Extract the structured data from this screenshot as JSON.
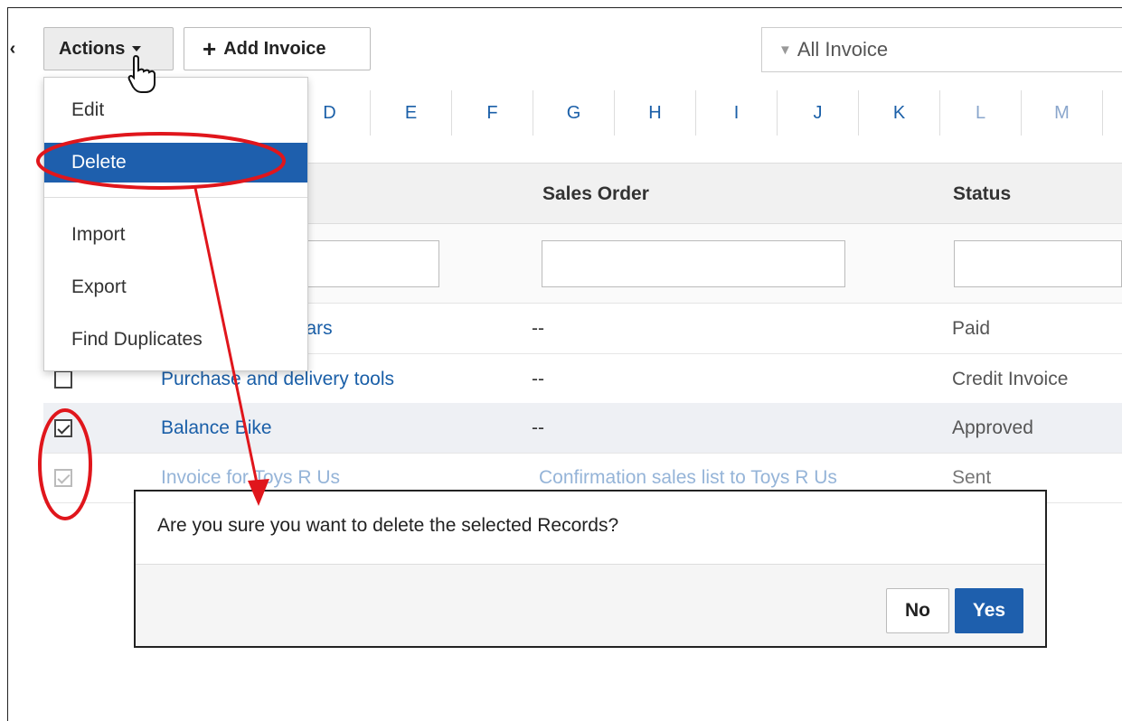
{
  "toolbar": {
    "actions_label": "Actions",
    "add_invoice_label": "Add Invoice",
    "filter_label": "All Invoice"
  },
  "alphabet": [
    "D",
    "E",
    "F",
    "G",
    "H",
    "I",
    "J",
    "K",
    "L",
    "M"
  ],
  "actions_menu": {
    "items": [
      {
        "label": "Edit"
      },
      {
        "label": "Delete"
      },
      {
        "label": "Import"
      },
      {
        "label": "Export"
      },
      {
        "label": "Find Duplicates"
      }
    ]
  },
  "table": {
    "headers": {
      "sales_order": "Sales Order",
      "status": "Status"
    },
    "rows": [
      {
        "subject": "cars",
        "sales_order": "--",
        "status": "Paid",
        "checked": false
      },
      {
        "subject": "Purchase and delivery tools",
        "sales_order": "--",
        "status": "Credit Invoice",
        "checked": false
      },
      {
        "subject": "Balance Bike",
        "sales_order": "--",
        "status": "Approved",
        "checked": true
      },
      {
        "subject": "Invoice for Toys R Us",
        "sales_order": "Confirmation sales list to Toys R Us",
        "status": "Sent",
        "checked": true
      }
    ]
  },
  "dialog": {
    "message": "Are you sure you want to delete the selected Records?",
    "no_label": "No",
    "yes_label": "Yes"
  },
  "colors": {
    "accent": "#1e5fad",
    "link": "#1a5fa8",
    "annotation": "#e0161c"
  }
}
